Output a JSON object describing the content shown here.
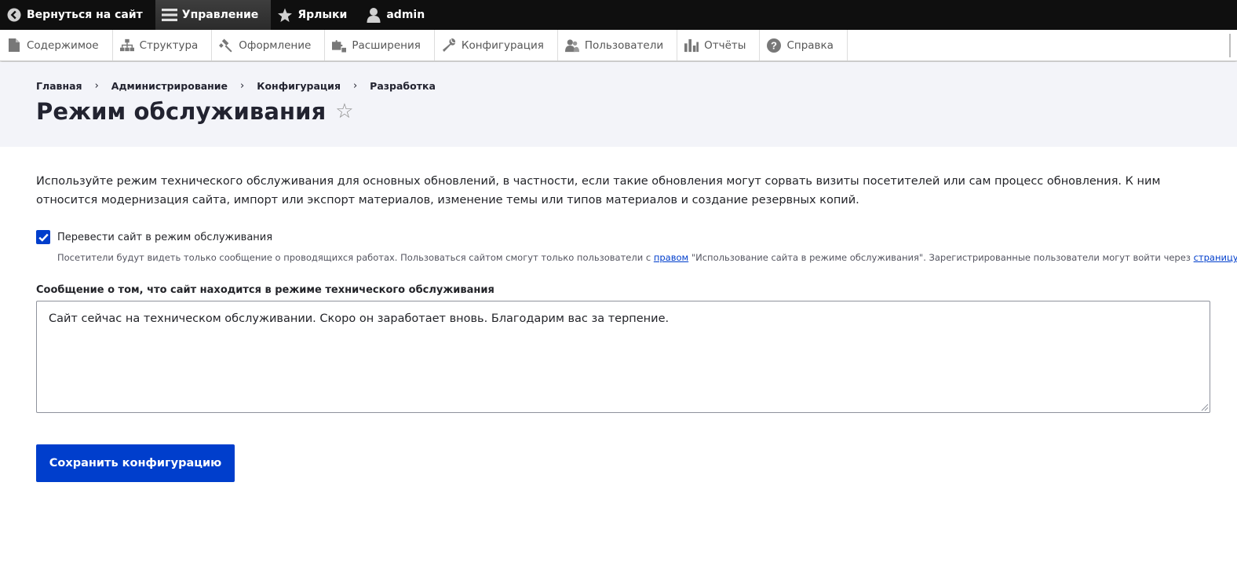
{
  "toolbar": {
    "back_label": "Вернуться на сайт",
    "manage_label": "Управление",
    "shortcuts_label": "Ярлыки",
    "user_label": "admin"
  },
  "tray": {
    "items": [
      {
        "label": "Содержимое",
        "icon": "file-icon"
      },
      {
        "label": "Структура",
        "icon": "sitemap-icon"
      },
      {
        "label": "Оформление",
        "icon": "paintbrush-icon"
      },
      {
        "label": "Расширения",
        "icon": "puzzle-icon"
      },
      {
        "label": "Конфигурация",
        "icon": "wrench-icon"
      },
      {
        "label": "Пользователи",
        "icon": "people-icon"
      },
      {
        "label": "Отчёты",
        "icon": "bar-chart-icon"
      },
      {
        "label": "Справка",
        "icon": "help-icon"
      }
    ]
  },
  "breadcrumb": {
    "items": [
      "Главная",
      "Администрирование",
      "Конфигурация",
      "Разработка"
    ],
    "separator": "›"
  },
  "page": {
    "title": "Режим обслуживания",
    "star": "☆"
  },
  "content": {
    "description": "Используйте режим технического обслуживания для основных обновлений, в частности, если такие обновления могут сорвать визиты посетителей или сам процесс обновления. К ним относится модернизация сайта, импорт или экспорт материалов, изменение темы или типов материалов и создание резервных копий.",
    "checkbox_label": "Перевести сайт в режим обслуживания",
    "checkbox_checked": true,
    "checkbox_desc_part1": "Посетители будут видеть только сообщение о проводящихся работах. Пользоваться сайтом смогут только пользователи с ",
    "checkbox_desc_link1": "правом",
    "checkbox_desc_part2": " \"Использование сайта в режиме обслуживания\". Зарегистрированные пользователи могут войти через ",
    "checkbox_desc_link2": "страницу входа",
    "checkbox_desc_part3": ".",
    "message_label": "Сообщение о том, что сайт находится в режиме технического обслуживания",
    "message_value": "Сайт сейчас на техническом обслуживании. Скоро он заработает вновь. Благодарим вас за терпение.",
    "save_label": "Сохранить конфигурацию"
  },
  "colors": {
    "accent": "#003ecc",
    "toolbar_bg": "#0f0f0f",
    "header_bg": "#f3f4f9"
  }
}
